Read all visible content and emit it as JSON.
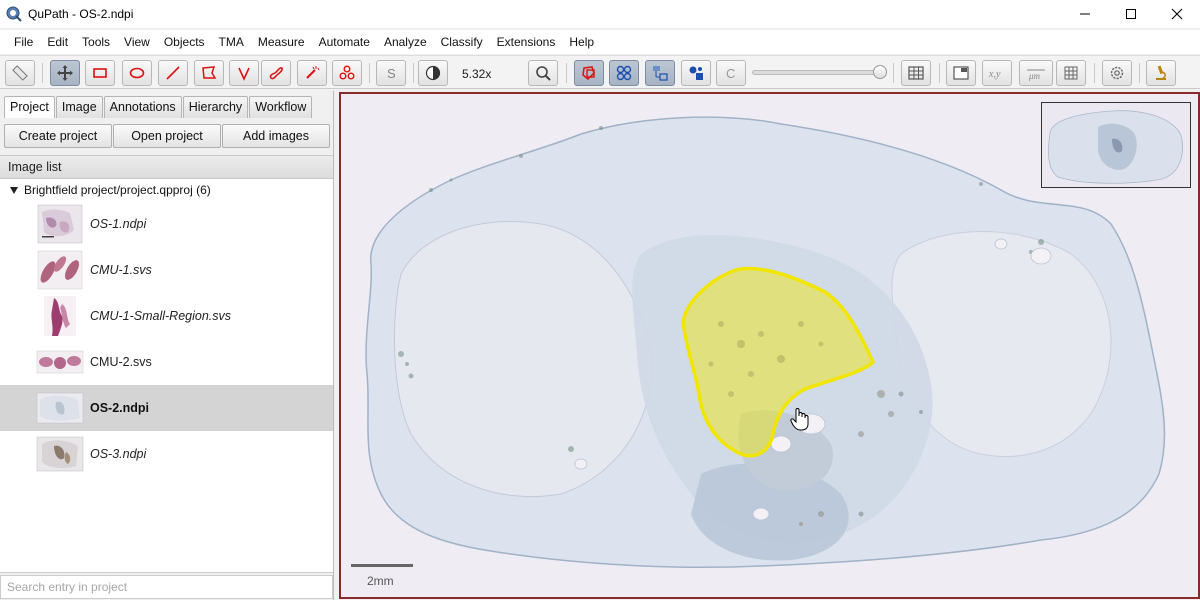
{
  "window": {
    "title": "QuPath - OS-2.ndpi"
  },
  "menu": [
    "File",
    "Edit",
    "Tools",
    "View",
    "Objects",
    "TMA",
    "Measure",
    "Automate",
    "Analyze",
    "Classify",
    "Extensions",
    "Help"
  ],
  "toolbar": {
    "zoom": "5.32x",
    "tools": [
      "measure-ruler-icon",
      "move-icon",
      "rectangle-icon",
      "ellipse-icon",
      "line-icon",
      "polygon-icon",
      "polyline-icon",
      "brush-icon",
      "wand-icon",
      "points-icon",
      "selection-mode-icon",
      "brightness-contrast-icon",
      "zoom-to-fit-icon",
      "show-annotations-icon",
      "show-tma-icon",
      "show-detections-icon",
      "fill-detections-icon",
      "cell-boundaries-icon",
      "measurement-table-icon",
      "overview-icon",
      "cursor-location-icon",
      "scalebar-icon",
      "grid-icon",
      "preferences-icon",
      "log-icon"
    ],
    "opacity_level": 0.95
  },
  "left_panel": {
    "tabs": [
      "Project",
      "Image",
      "Annotations",
      "Hierarchy",
      "Workflow"
    ],
    "active_tab": "Project",
    "buttons": {
      "create": "Create project",
      "open": "Open project",
      "add": "Add images"
    },
    "image_list_header": "Image list",
    "tree_root": "Brightfield project/project.qpproj (6)",
    "entries": [
      {
        "name": "OS-1.ndpi",
        "style": "italic"
      },
      {
        "name": "CMU-1.svs",
        "style": "italic"
      },
      {
        "name": "CMU-1-Small-Region.svs",
        "style": "italic"
      },
      {
        "name": "CMU-2.svs",
        "style": "plain"
      },
      {
        "name": "OS-2.ndpi",
        "style": "bold"
      },
      {
        "name": "OS-3.ndpi",
        "style": "italic"
      }
    ],
    "selected_entry": "OS-2.ndpi",
    "search_placeholder": "Search entry in project"
  },
  "viewer": {
    "scale_label": "2mm",
    "annotation_color": "#f2e600",
    "frame_color": "#8a2b2b"
  }
}
